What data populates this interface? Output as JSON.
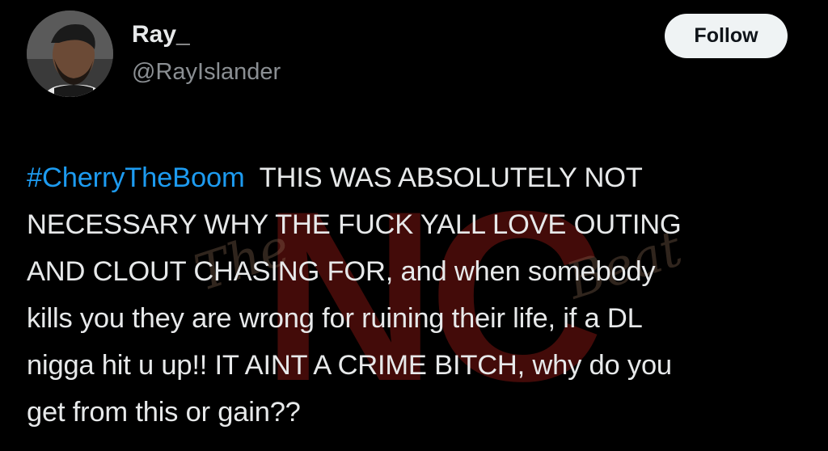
{
  "user": {
    "display_name": "Ray_",
    "handle": "@RayIslander"
  },
  "follow_label": "Follow",
  "tweet": {
    "hashtag": "#CherryTheBoom",
    "lines": [
      "THIS WAS ABSOLUTELY NOT",
      "NECESSARY WHY THE FUCK YALL LOVE OUTING",
      "AND CLOUT CHASING FOR, and when somebody",
      "kills you they are wrong for ruining their life, if a DL",
      "nigga hit u up!! IT AINT A CRIME BITCH, why do you",
      "get from this or gain??"
    ]
  },
  "watermark": {
    "main": "NC",
    "left_script": "The",
    "right_script": "Beat"
  },
  "colors": {
    "background": "#000000",
    "text": "#e7e9ea",
    "handle": "#8b8f93",
    "hashtag": "#1d9bf0",
    "follow_bg": "#eff3f4",
    "follow_text": "#0f1419",
    "watermark_red": "#7a1512"
  }
}
